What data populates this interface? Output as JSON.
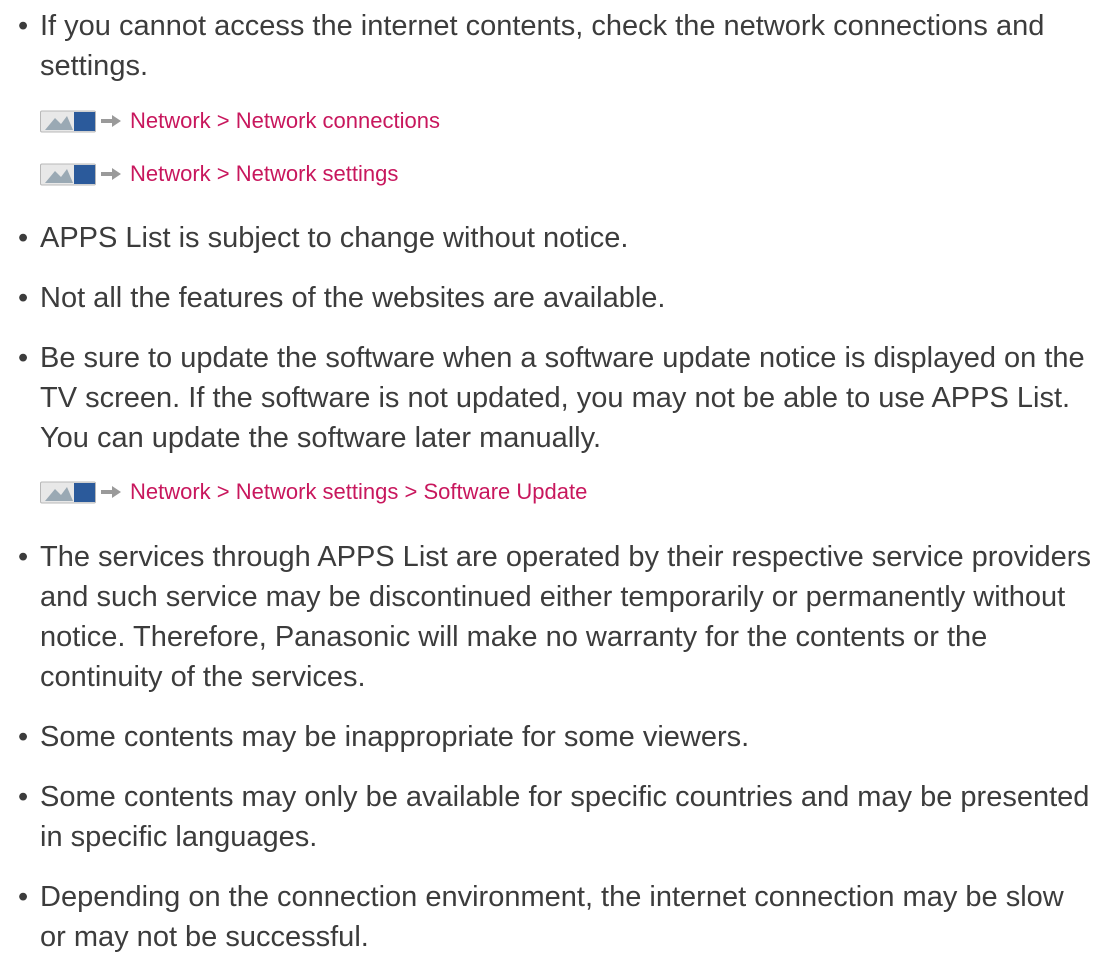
{
  "bullets": [
    {
      "text": "If you cannot access the internet contents, check the network connections and settings.",
      "menu_paths": [
        "Network > Network connections",
        "Network > Network settings"
      ]
    },
    {
      "text": "APPS List is subject to change without notice."
    },
    {
      "text": "Not all the features of the websites are available."
    },
    {
      "text": "Be sure to update the software when a software update notice is displayed on the TV screen. If the software is not updated, you may not be able to use APPS List. You can update the software later manually.",
      "menu_paths": [
        "Network > Network settings > Software Update"
      ]
    },
    {
      "text": "The services through APPS List are operated by their respective service providers and such service may be discontinued either temporarily or permanently without notice. Therefore, Panasonic will make no warranty for the contents or the continuity of the services."
    },
    {
      "text": "Some contents may be inappropriate for some viewers."
    },
    {
      "text": "Some contents may only be available for specific countries and may be presented in specific languages."
    },
    {
      "text": "Depending on the connection environment, the internet connection may be slow or may not be successful."
    }
  ],
  "bullet_symbol": "•",
  "icons": {
    "menu": "menu-icon",
    "arrow": "arrow-right-icon"
  },
  "colors": {
    "body_text": "#3c3c3c",
    "menu_path": "#c8175d",
    "arrow": "#9a9a9a"
  }
}
